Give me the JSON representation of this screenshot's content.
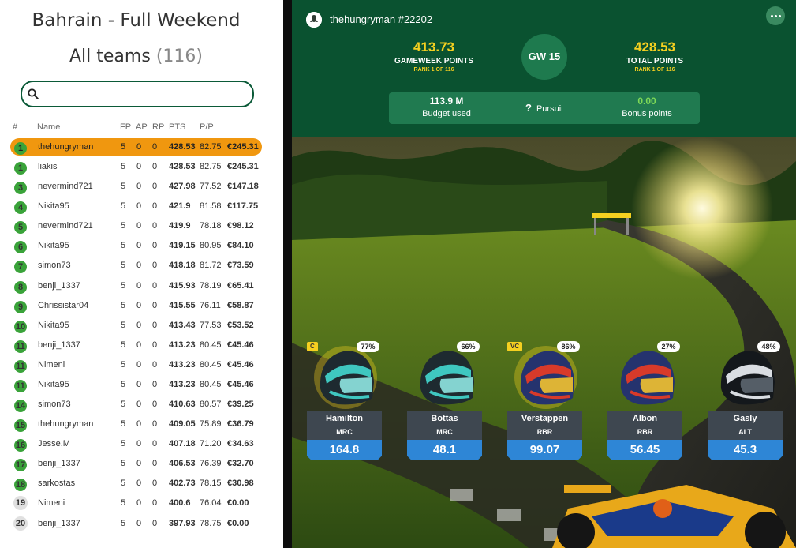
{
  "left": {
    "event_title": "Bahrain - Full Weekend",
    "teams_label": "All teams",
    "teams_count": "(116)",
    "search": {
      "placeholder": "",
      "value": ""
    },
    "columns": [
      "#",
      "Name",
      "FP",
      "AP",
      "RP",
      "PTS",
      "P/P"
    ],
    "rows": [
      {
        "rank": "1",
        "name": "thehungryman",
        "fp": "5",
        "ap": "0",
        "rp": "0",
        "pts": "428.53",
        "pp": "82.75",
        "value": "€245.31",
        "selected": true
      },
      {
        "rank": "1",
        "name": "liakis",
        "fp": "5",
        "ap": "0",
        "rp": "0",
        "pts": "428.53",
        "pp": "82.75",
        "value": "€245.31"
      },
      {
        "rank": "3",
        "name": "nevermind721",
        "fp": "5",
        "ap": "0",
        "rp": "0",
        "pts": "427.98",
        "pp": "77.52",
        "value": "€147.18"
      },
      {
        "rank": "4",
        "name": "Nikita95",
        "fp": "5",
        "ap": "0",
        "rp": "0",
        "pts": "421.9",
        "pp": "81.58",
        "value": "€117.75"
      },
      {
        "rank": "5",
        "name": "nevermind721",
        "fp": "5",
        "ap": "0",
        "rp": "0",
        "pts": "419.9",
        "pp": "78.18",
        "value": "€98.12"
      },
      {
        "rank": "6",
        "name": "Nikita95",
        "fp": "5",
        "ap": "0",
        "rp": "0",
        "pts": "419.15",
        "pp": "80.95",
        "value": "€84.10"
      },
      {
        "rank": "7",
        "name": "simon73",
        "fp": "5",
        "ap": "0",
        "rp": "0",
        "pts": "418.18",
        "pp": "81.72",
        "value": "€73.59"
      },
      {
        "rank": "8",
        "name": "benji_1337",
        "fp": "5",
        "ap": "0",
        "rp": "0",
        "pts": "415.93",
        "pp": "78.19",
        "value": "€65.41"
      },
      {
        "rank": "9",
        "name": "Chrissistar04",
        "fp": "5",
        "ap": "0",
        "rp": "0",
        "pts": "415.55",
        "pp": "76.11",
        "value": "€58.87"
      },
      {
        "rank": "10",
        "name": "Nikita95",
        "fp": "5",
        "ap": "0",
        "rp": "0",
        "pts": "413.43",
        "pp": "77.53",
        "value": "€53.52"
      },
      {
        "rank": "11",
        "name": "benji_1337",
        "fp": "5",
        "ap": "0",
        "rp": "0",
        "pts": "413.23",
        "pp": "80.45",
        "value": "€45.46"
      },
      {
        "rank": "11",
        "name": "Nimeni",
        "fp": "5",
        "ap": "0",
        "rp": "0",
        "pts": "413.23",
        "pp": "80.45",
        "value": "€45.46"
      },
      {
        "rank": "11",
        "name": "Nikita95",
        "fp": "5",
        "ap": "0",
        "rp": "0",
        "pts": "413.23",
        "pp": "80.45",
        "value": "€45.46"
      },
      {
        "rank": "14",
        "name": "simon73",
        "fp": "5",
        "ap": "0",
        "rp": "0",
        "pts": "410.63",
        "pp": "80.57",
        "value": "€39.25"
      },
      {
        "rank": "15",
        "name": "thehungryman",
        "fp": "5",
        "ap": "0",
        "rp": "0",
        "pts": "409.05",
        "pp": "75.89",
        "value": "€36.79"
      },
      {
        "rank": "16",
        "name": "Jesse.M",
        "fp": "5",
        "ap": "0",
        "rp": "0",
        "pts": "407.18",
        "pp": "71.20",
        "value": "€34.63"
      },
      {
        "rank": "17",
        "name": "benji_1337",
        "fp": "5",
        "ap": "0",
        "rp": "0",
        "pts": "406.53",
        "pp": "76.39",
        "value": "€32.70"
      },
      {
        "rank": "18",
        "name": "sarkostas",
        "fp": "5",
        "ap": "0",
        "rp": "0",
        "pts": "402.73",
        "pp": "78.15",
        "value": "€30.98"
      },
      {
        "rank": "19",
        "name": "Nimeni",
        "fp": "5",
        "ap": "0",
        "rp": "0",
        "pts": "400.6",
        "pp": "76.04",
        "value": "€0.00",
        "gray": true
      },
      {
        "rank": "20",
        "name": "benji_1337",
        "fp": "5",
        "ap": "0",
        "rp": "0",
        "pts": "397.93",
        "pp": "78.75",
        "value": "€0.00",
        "gray": true
      }
    ]
  },
  "right": {
    "user": "thehungryman #22202",
    "gameweek_points": {
      "value": "413.73",
      "label": "GAMEWEEK POINTS",
      "rank": "RANK 1 OF 116"
    },
    "gw": "GW 15",
    "total_points": {
      "value": "428.53",
      "label": "TOTAL POINTS",
      "rank": "RANK 1 OF 116"
    },
    "budget": {
      "value": "113.9 M",
      "label": "Budget used"
    },
    "pursuit": {
      "icon": "?",
      "label": "Pursuit"
    },
    "bonus": {
      "value": "0.00",
      "label": "Bonus points"
    },
    "drivers": [
      {
        "name": "Hamilton",
        "team": "MRC",
        "points": "164.8",
        "pct": "77%",
        "tag": "C",
        "helmet": "teal"
      },
      {
        "name": "Bottas",
        "team": "MRC",
        "points": "48.1",
        "pct": "66%",
        "tag": "",
        "helmet": "teal"
      },
      {
        "name": "Verstappen",
        "team": "RBR",
        "points": "99.07",
        "pct": "86%",
        "tag": "VC",
        "helmet": "rbr"
      },
      {
        "name": "Albon",
        "team": "RBR",
        "points": "56.45",
        "pct": "27%",
        "tag": "",
        "helmet": "rbr"
      },
      {
        "name": "Gasly",
        "team": "ALT",
        "points": "45.3",
        "pct": "48%",
        "tag": "",
        "helmet": "alt"
      }
    ]
  },
  "colors": {
    "header_green": "#0a5230",
    "accent_yellow": "#f5d020",
    "selected_row": "#f0970f",
    "rank_badge": "#3aa33a",
    "points_blue": "#2e86d6"
  },
  "icons": [
    "search-icon",
    "user-avatar-icon",
    "more-options-icon",
    "question-icon"
  ]
}
